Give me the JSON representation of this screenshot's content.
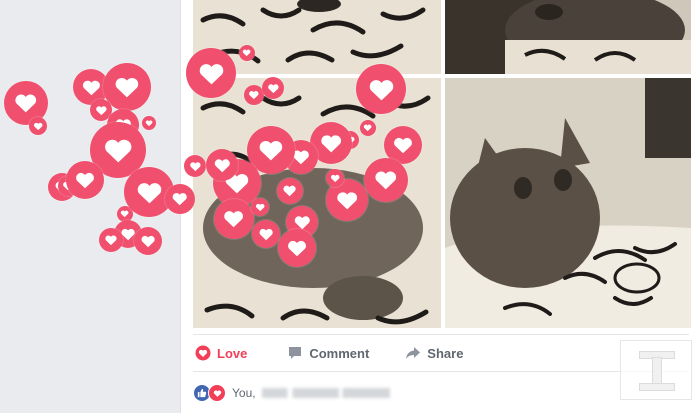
{
  "post": {
    "actions": {
      "love_label": "Love",
      "comment_label": "Comment",
      "share_label": "Share"
    },
    "reactions": {
      "names_prefix": "You,"
    }
  },
  "colors": {
    "love_red": "#f33e58",
    "heart_bubble": "#f0506e",
    "like_blue": "#4267b2",
    "action_grey": "#606770"
  },
  "icons": {
    "love_action": "heart-outline-icon",
    "comment_action": "speech-bubble-icon",
    "share_action": "share-arrow-icon",
    "like_reaction": "thumbs-up-icon",
    "love_reaction": "heart-icon",
    "floating": "heart-icon"
  }
}
